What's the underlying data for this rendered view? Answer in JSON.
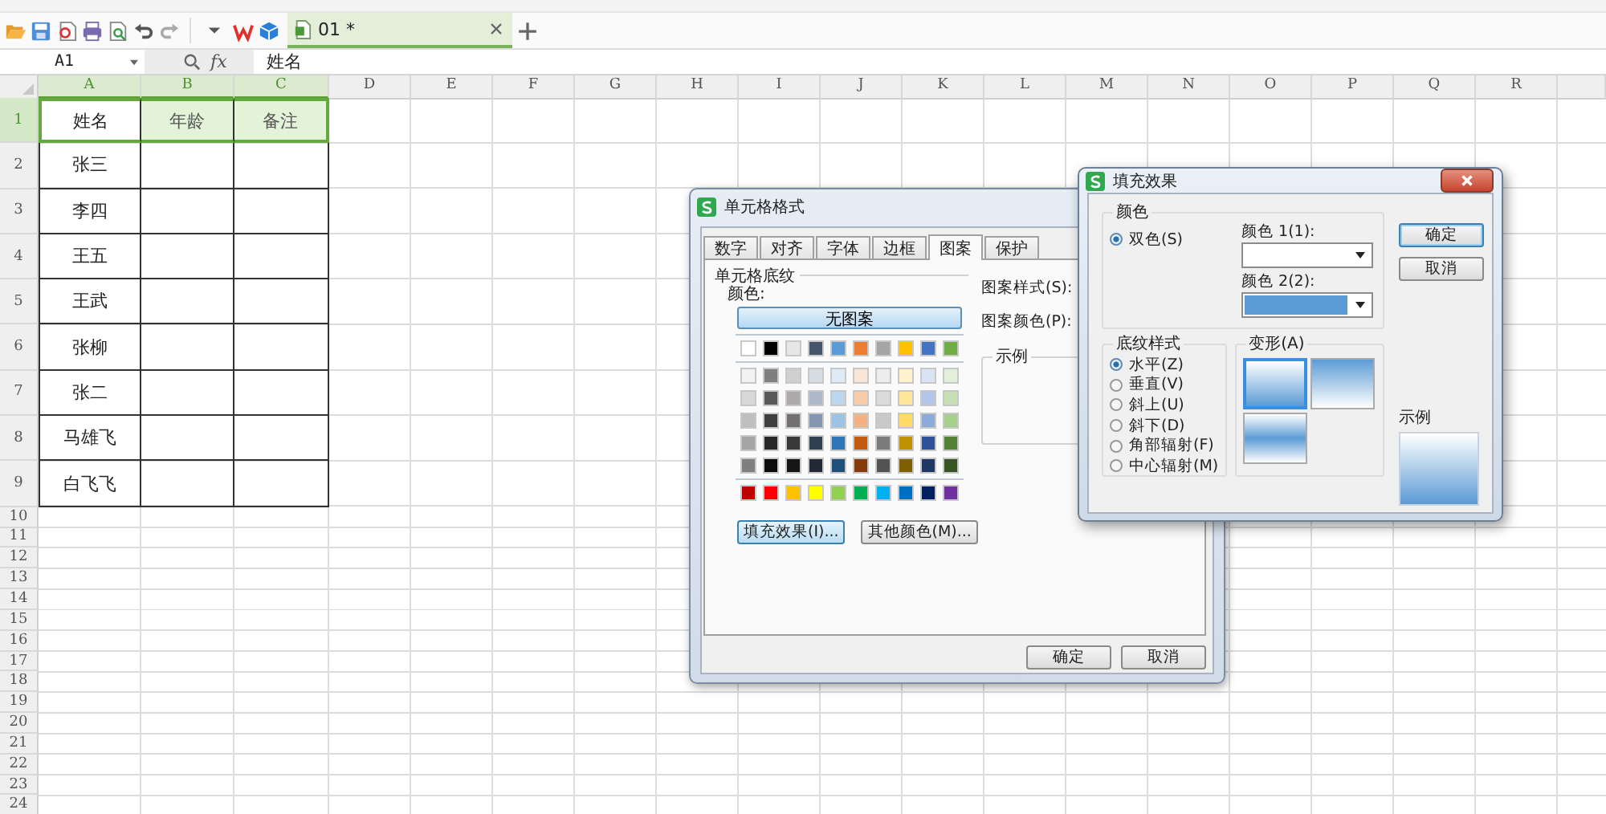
{
  "toolbar": {
    "document_tab": "01 *"
  },
  "formula_bar": {
    "name_box": "A1",
    "fx": "fx",
    "value": "姓名"
  },
  "sheet": {
    "columns": [
      {
        "label": "A",
        "selected": true
      },
      {
        "label": "B",
        "selected": true
      },
      {
        "label": "C",
        "selected": true
      },
      {
        "label": "D",
        "selected": false
      },
      {
        "label": "E",
        "selected": false
      },
      {
        "label": "F",
        "selected": false
      },
      {
        "label": "G",
        "selected": false
      },
      {
        "label": "H",
        "selected": false
      },
      {
        "label": "I",
        "selected": false
      },
      {
        "label": "J",
        "selected": false
      },
      {
        "label": "K",
        "selected": false
      },
      {
        "label": "L",
        "selected": false
      },
      {
        "label": "M",
        "selected": false
      },
      {
        "label": "N",
        "selected": false
      },
      {
        "label": "O",
        "selected": false
      },
      {
        "label": "P",
        "selected": false
      },
      {
        "label": "Q",
        "selected": false
      },
      {
        "label": "R",
        "selected": false
      }
    ],
    "rows": [
      {
        "label": "1",
        "selected": true,
        "bordered": true,
        "cells": [
          "姓名",
          "年龄",
          "备注"
        ]
      },
      {
        "label": "2",
        "selected": false,
        "bordered": true,
        "cells": [
          "张三"
        ]
      },
      {
        "label": "3",
        "selected": false,
        "bordered": true,
        "cells": [
          "李四"
        ]
      },
      {
        "label": "4",
        "selected": false,
        "bordered": true,
        "cells": [
          "王五"
        ]
      },
      {
        "label": "5",
        "selected": false,
        "bordered": true,
        "cells": [
          "王武"
        ]
      },
      {
        "label": "6",
        "selected": false,
        "bordered": true,
        "cells": [
          "张柳"
        ]
      },
      {
        "label": "7",
        "selected": false,
        "bordered": true,
        "cells": [
          "张二"
        ]
      },
      {
        "label": "8",
        "selected": false,
        "bordered": true,
        "cells": [
          "马雄飞"
        ]
      },
      {
        "label": "9",
        "selected": false,
        "bordered": true,
        "cells": [
          "白飞飞"
        ]
      },
      {
        "label": "10",
        "selected": false,
        "bordered": false
      },
      {
        "label": "11",
        "selected": false,
        "bordered": false
      },
      {
        "label": "12",
        "selected": false,
        "bordered": false
      },
      {
        "label": "13",
        "selected": false,
        "bordered": false
      },
      {
        "label": "14",
        "selected": false,
        "bordered": false
      },
      {
        "label": "15",
        "selected": false,
        "bordered": false
      },
      {
        "label": "16",
        "selected": false,
        "bordered": false
      },
      {
        "label": "17",
        "selected": false,
        "bordered": false
      },
      {
        "label": "18",
        "selected": false,
        "bordered": false
      },
      {
        "label": "19",
        "selected": false,
        "bordered": false
      },
      {
        "label": "20",
        "selected": false,
        "bordered": false
      },
      {
        "label": "21",
        "selected": false,
        "bordered": false
      },
      {
        "label": "22",
        "selected": false,
        "bordered": false
      },
      {
        "label": "23",
        "selected": false,
        "bordered": false
      },
      {
        "label": "24",
        "selected": false,
        "bordered": false
      }
    ]
  },
  "cell_format_dialog": {
    "title": "单元格格式",
    "tabs": [
      {
        "label": "数字",
        "selected": false
      },
      {
        "label": "对齐",
        "selected": false
      },
      {
        "label": "字体",
        "selected": false
      },
      {
        "label": "边框",
        "selected": false
      },
      {
        "label": "图案",
        "selected": true
      },
      {
        "label": "保护",
        "selected": false
      }
    ],
    "group": "单元格底纹",
    "color_label": "颜色:",
    "no_pattern_button": "无图案",
    "palette": {
      "theme": [
        {
          "color": "#ffffff"
        },
        {
          "color": "#000000"
        },
        {
          "color": "#e7e6e6"
        },
        {
          "color": "#44546a"
        },
        {
          "color": "#5b9bd5"
        },
        {
          "color": "#ed7d31"
        },
        {
          "color": "#a5a5a5"
        },
        {
          "color": "#ffc000"
        },
        {
          "color": "#4472c4"
        },
        {
          "color": "#70ad47"
        }
      ],
      "shades": [
        [
          {
            "color": "#f2f2f2"
          },
          {
            "color": "#7f7f7f"
          },
          {
            "color": "#d0cece"
          },
          {
            "color": "#d6dce4"
          },
          {
            "color": "#deebf6"
          },
          {
            "color": "#fbe5d5"
          },
          {
            "color": "#ededed"
          },
          {
            "color": "#fff2cc"
          },
          {
            "color": "#dae3f3"
          },
          {
            "color": "#e2efd9"
          }
        ],
        [
          {
            "color": "#d8d8d8"
          },
          {
            "color": "#595959"
          },
          {
            "color": "#aeaaaa"
          },
          {
            "color": "#adb9ca"
          },
          {
            "color": "#bdd7ee"
          },
          {
            "color": "#f7cbac"
          },
          {
            "color": "#dbdbdb"
          },
          {
            "color": "#fee599"
          },
          {
            "color": "#b4c6e7"
          },
          {
            "color": "#c5e0b3"
          }
        ],
        [
          {
            "color": "#bfbfbf"
          },
          {
            "color": "#3f3f3f"
          },
          {
            "color": "#757070"
          },
          {
            "color": "#8496b0"
          },
          {
            "color": "#9cc3e5"
          },
          {
            "color": "#f4b183"
          },
          {
            "color": "#c9c9c9"
          },
          {
            "color": "#ffd965"
          },
          {
            "color": "#8eaadb"
          },
          {
            "color": "#a8d08d"
          }
        ],
        [
          {
            "color": "#a5a5a5"
          },
          {
            "color": "#262626"
          },
          {
            "color": "#3a3838"
          },
          {
            "color": "#323f4f"
          },
          {
            "color": "#2e75b5"
          },
          {
            "color": "#c55a11"
          },
          {
            "color": "#7b7b7b"
          },
          {
            "color": "#bf9000"
          },
          {
            "color": "#2f5496"
          },
          {
            "color": "#538135"
          }
        ],
        [
          {
            "color": "#7f7f7f"
          },
          {
            "color": "#0c0c0c"
          },
          {
            "color": "#171616"
          },
          {
            "color": "#222a35"
          },
          {
            "color": "#1e4e79"
          },
          {
            "color": "#843c0b"
          },
          {
            "color": "#525252"
          },
          {
            "color": "#7f6000"
          },
          {
            "color": "#1f3864"
          },
          {
            "color": "#375623"
          }
        ]
      ],
      "standard": [
        {
          "color": "#c00000"
        },
        {
          "color": "#ff0000"
        },
        {
          "color": "#ffc000"
        },
        {
          "color": "#ffff00"
        },
        {
          "color": "#92d050"
        },
        {
          "color": "#00b050"
        },
        {
          "color": "#00b0f0"
        },
        {
          "color": "#0070c0"
        },
        {
          "color": "#002060"
        },
        {
          "color": "#7030a0"
        }
      ]
    },
    "fill_effects_button": "填充效果(I)...",
    "more_colors_button": "其他颜色(M)...",
    "pattern_style_label": "图案样式(S):",
    "pattern_color_label": "图案颜色(P):",
    "sample_label": "示例",
    "ok_button": "确定",
    "cancel_button": "取消"
  },
  "fill_effects_dialog": {
    "title": "填充效果",
    "color_group": "颜色",
    "color_modes": [
      {
        "label": "双色(S)",
        "selected": true
      }
    ],
    "color1": {
      "label": "颜色 1(1):",
      "color": "#ffffff"
    },
    "color2": {
      "label": "颜色 2(2):",
      "color": "#5b9bd5"
    },
    "shading_group": "底纹样式",
    "shading_styles": [
      {
        "label": "水平(Z)",
        "selected": true
      },
      {
        "label": "垂直(V)",
        "selected": false
      },
      {
        "label": "斜上(U)",
        "selected": false
      },
      {
        "label": "斜下(D)",
        "selected": false
      },
      {
        "label": "角部辐射(F)",
        "selected": false
      },
      {
        "label": "中心辐射(M)",
        "selected": false
      }
    ],
    "variants_group": "变形(A)",
    "variants": [
      {
        "kind": "down",
        "selected": true
      },
      {
        "kind": "up",
        "selected": false
      },
      {
        "kind": "middle",
        "selected": false
      }
    ],
    "sample_label": "示例",
    "ok_button": "确定",
    "cancel_button": "取消"
  }
}
